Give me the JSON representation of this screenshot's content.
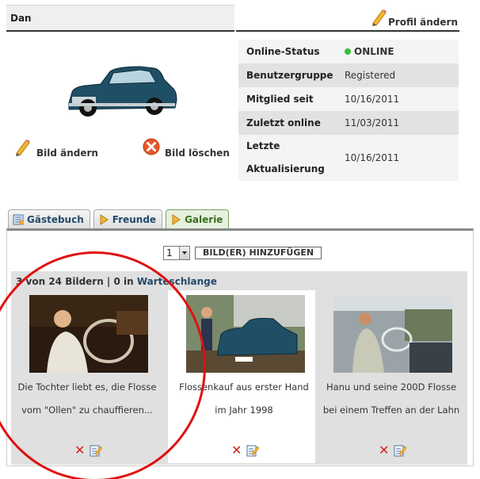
{
  "user": {
    "name": "Dan"
  },
  "profile": {
    "edit_label": "Profil ändern"
  },
  "picture": {
    "edit_label": "Bild ändern",
    "delete_label": "Bild löschen"
  },
  "info": [
    {
      "key": "Online-Status",
      "value": "ONLINE"
    },
    {
      "key": "Benutzergruppe",
      "value": "Registered"
    },
    {
      "key": "Mitglied seit",
      "value": "10/16/2011"
    },
    {
      "key": "Zuletzt online",
      "value": "11/03/2011"
    },
    {
      "key": "Letzte Aktualisierung",
      "value": "10/16/2011"
    }
  ],
  "tabs": [
    {
      "label": "Gästebuch",
      "active": false
    },
    {
      "label": "Freunde",
      "active": false
    },
    {
      "label": "Galerie",
      "active": true
    }
  ],
  "gallery": {
    "page_value": "1",
    "add_button": "BILD(ER) HINZUFÜGEN",
    "count_text": "3 von 24 Bildern | 0 in ",
    "queue_text": "Warteschlange",
    "items": [
      {
        "caption_1": "Die Tochter liebt es, die Flosse",
        "caption_2": "vom \"Ollen\" zu chauffieren..."
      },
      {
        "caption_1": "Flossenkauf aus erster Hand",
        "caption_2": "im Jahr 1998"
      },
      {
        "caption_1": "Hanu und seine 200D Flosse",
        "caption_2": "bei einem Treffen an der Lahn"
      }
    ]
  },
  "colors": {
    "online": "#2a9d2a",
    "annotation": "#e01010",
    "tab_active": "#3a6f1e",
    "link": "#244a6e"
  },
  "icons": [
    "pencil-icon",
    "delete-circle-icon",
    "guestbook-icon",
    "friends-icon",
    "gallery-icon",
    "delete-x-icon",
    "edit-note-icon",
    "chevron-down-icon"
  ]
}
